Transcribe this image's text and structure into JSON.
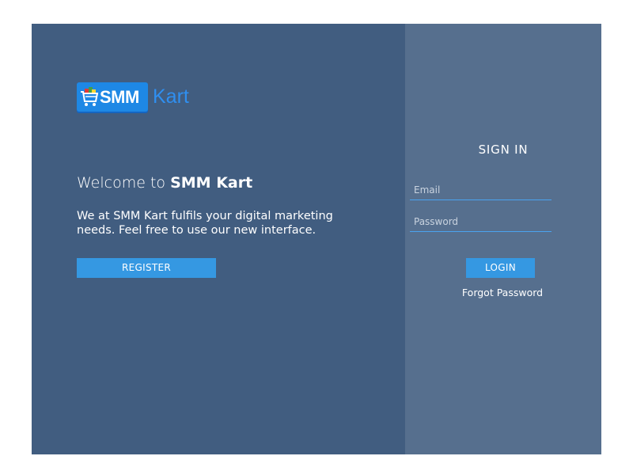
{
  "logo": {
    "badge_text": "SMM",
    "suffix_text": "Kart",
    "icon": "shopping-cart-icon"
  },
  "welcome": {
    "prefix": "Welcome to",
    "brand": "SMM Kart"
  },
  "description": "We at SMM Kart fulfils your digital marketing needs. Feel free to use our new interface.",
  "register_label": "REGISTER",
  "signin": {
    "title": "SIGN IN",
    "email_placeholder": "Email",
    "password_placeholder": "Password",
    "login_label": "LOGIN",
    "forgot_label": "Forgot Password"
  },
  "colors": {
    "left_panel": "#415d80",
    "right_panel": "#566f8e",
    "accent": "#3598e2"
  }
}
